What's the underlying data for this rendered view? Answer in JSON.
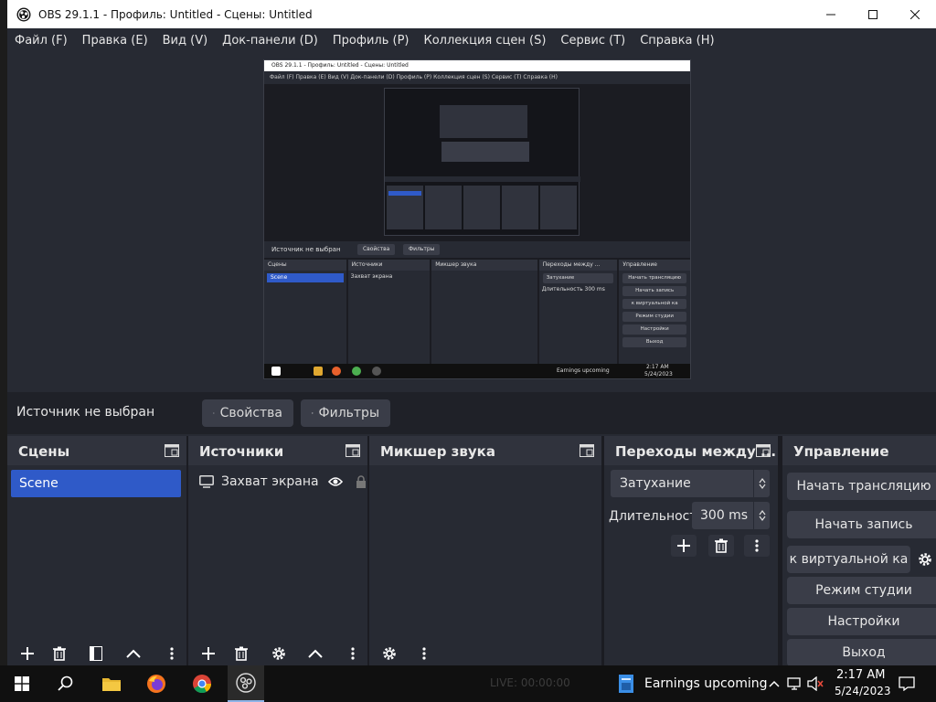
{
  "window": {
    "title": "OBS 29.1.1 - Профиль: Untitled - Сцены: Untitled",
    "controls": {
      "minimize": "—",
      "maximize": "☐",
      "close": "✕"
    }
  },
  "menu": [
    "Файл (F)",
    "Правка (E)",
    "Вид (V)",
    "Док-панели (D)",
    "Профиль (P)",
    "Коллекция сцен (S)",
    "Сервис (T)",
    "Справка (H)"
  ],
  "preview": {
    "title": "OBS 29.1.1 - Профиль: Untitled - Сцены: Untitled",
    "menu": "Файл (F)   Правка (E)   Вид (V)   Док-панели (D)   Профиль (P)   Коллекция сцен (S)   Сервис (T)   Справка (H)",
    "source_label": "Источник не выбран",
    "props": "Свойства",
    "filters": "Фильтры",
    "docks": [
      "Сцены",
      "Источники",
      "Микшер звука",
      "Переходы между ...",
      "Управление"
    ],
    "scene": "Scene",
    "source": "Захват экрана",
    "transition": "Затухание",
    "duration_label": "Длительность",
    "duration": "300 ms",
    "controls": [
      "Начать трансляцию",
      "Начать запись",
      "к виртуальной ка",
      "Режим студии",
      "Настройки",
      "Выход"
    ],
    "taskbar_news": "Earnings upcoming",
    "clock_time": "2:17 AM",
    "clock_date": "5/24/2023"
  },
  "source_bar": {
    "label": "Источник не выбран",
    "properties": "Свойства",
    "filters": "Фильтры"
  },
  "scenes": {
    "title": "Сцены",
    "items": [
      "Scene"
    ]
  },
  "sources": {
    "title": "Источники",
    "items": [
      "Захват экрана"
    ]
  },
  "mixer": {
    "title": "Микшер звука"
  },
  "transitions": {
    "title": "Переходы между ...",
    "selected": "Затухание",
    "duration_label": "Длительность",
    "duration": "300 ms"
  },
  "controls": {
    "title": "Управление",
    "start_stream": "Начать трансляцию",
    "start_record": "Начать запись",
    "virtual_cam": "к виртуальной ка",
    "studio_mode": "Режим студии",
    "settings": "Настройки",
    "exit": "Выход"
  },
  "taskbar": {
    "status_live": "LIVE: 00:00:00",
    "news": "Earnings upcoming",
    "time": "2:17 AM",
    "date": "5/24/2023"
  }
}
